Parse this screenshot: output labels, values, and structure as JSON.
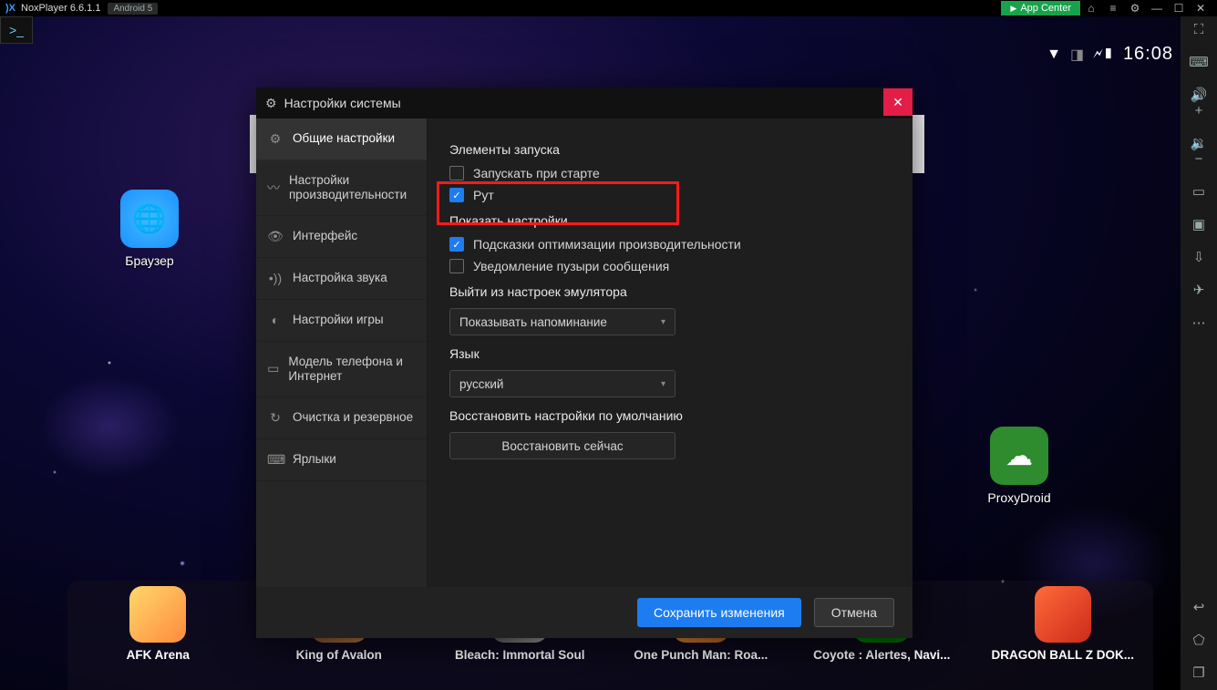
{
  "titlebar": {
    "app_name": "NoxPlayer",
    "version": "6.6.1.1",
    "android_badge": "Android 5",
    "app_center": "App Center"
  },
  "statusbar": {
    "time": "16:08"
  },
  "desktop": {
    "browser_label": "Браузер",
    "proxydroid_label": "ProxyDroid"
  },
  "dock": {
    "items": [
      "AFK Arena",
      "King of Avalon",
      "Bleach: Immortal Soul",
      "One Punch Man: Roa...",
      "Coyote : Alertes, Navi...",
      "DRAGON BALL Z DOK..."
    ]
  },
  "modal": {
    "title": "Настройки системы",
    "sidebar": [
      "Общие настройки",
      "Настройки производительности",
      "Интерфейс",
      "Настройка звука",
      "Настройки игры",
      "Модель телефона и Интернет",
      "Очистка и резервное",
      "Ярлыки"
    ],
    "sections": {
      "startup_title": "Элементы запуска",
      "start_on_boot": "Запускать при старте",
      "root": "Рут",
      "show_title": "Показать настройки",
      "perf_tips": "Подсказки оптимизации производительности",
      "msg_bubbles": "Уведомление пузыри сообщения",
      "exit_title": "Выйти из настроек эмулятора",
      "exit_select": "Показывать напоминание",
      "lang_title": "Язык",
      "lang_select": "русский",
      "restore_title": "Восстановить настройки по умолчанию",
      "restore_btn": "Восстановить сейчас"
    },
    "buttons": {
      "save": "Сохранить изменения",
      "cancel": "Отмена"
    }
  }
}
